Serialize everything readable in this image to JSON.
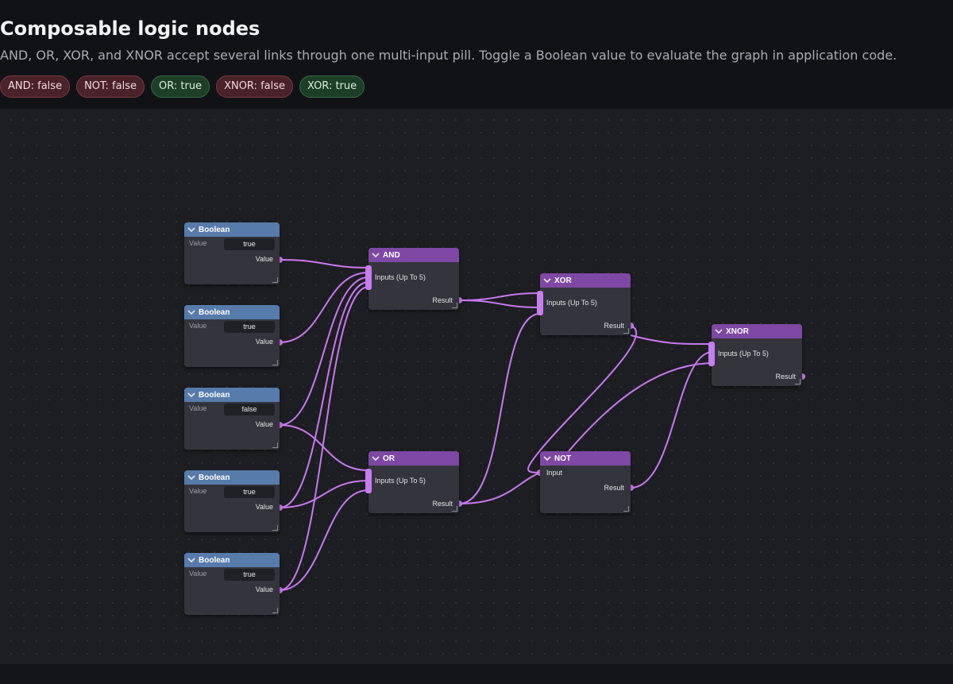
{
  "page": {
    "title": "Composable logic nodes",
    "subtitle": "AND, OR, XOR, and XNOR accept several links through one multi-input pill. Toggle a Boolean value to evaluate the graph in application code."
  },
  "badges": [
    {
      "label": "AND: false",
      "state": false
    },
    {
      "label": "NOT: false",
      "state": false
    },
    {
      "label": "OR: true",
      "state": true
    },
    {
      "label": "XNOR: false",
      "state": false
    },
    {
      "label": "XOR: true",
      "state": true
    }
  ],
  "colors": {
    "boolean_header": "#577bab",
    "logic_header": "#7e48a4",
    "wire": "#c879f0",
    "badge_true": "#1d3f27",
    "badge_false": "#4a2229"
  },
  "nodes": {
    "bool1": {
      "title": "Boolean",
      "field_label": "Value",
      "value": "true",
      "output": "Value"
    },
    "bool2": {
      "title": "Boolean",
      "field_label": "Value",
      "value": "true",
      "output": "Value"
    },
    "bool3": {
      "title": "Boolean",
      "field_label": "Value",
      "value": "false",
      "output": "Value"
    },
    "bool4": {
      "title": "Boolean",
      "field_label": "Value",
      "value": "true",
      "output": "Value"
    },
    "bool5": {
      "title": "Boolean",
      "field_label": "Value",
      "value": "true",
      "output": "Value"
    },
    "and": {
      "title": "AND",
      "input": "Inputs (Up To 5)",
      "output": "Result"
    },
    "or": {
      "title": "OR",
      "input": "Inputs (Up To 5)",
      "output": "Result"
    },
    "xor": {
      "title": "XOR",
      "input": "Inputs (Up To 5)",
      "output": "Result"
    },
    "not": {
      "title": "NOT",
      "input": "Input",
      "output": "Result"
    },
    "xnor": {
      "title": "XNOR",
      "input": "Inputs (Up To 5)",
      "output": "Result"
    }
  },
  "icons": {
    "collapse": "chevron-down-icon",
    "resize": "resize-handle-icon"
  }
}
